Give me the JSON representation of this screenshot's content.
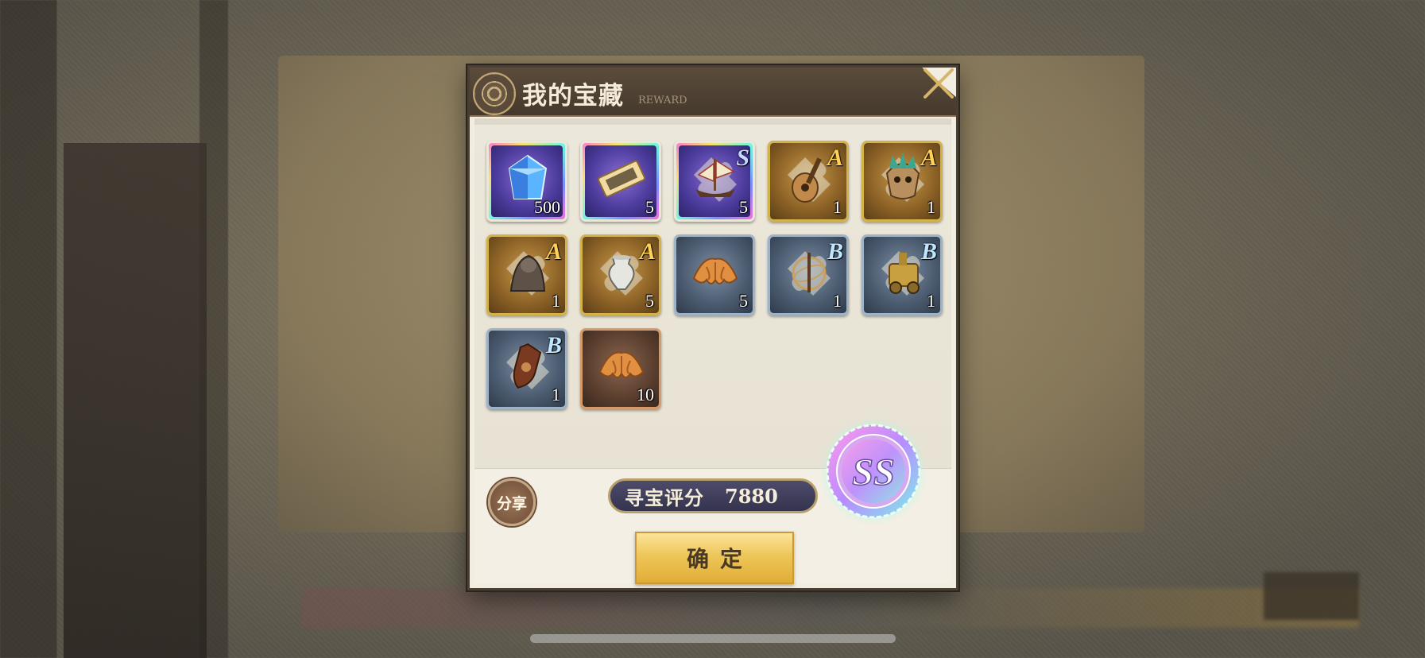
{
  "dialog": {
    "title": "我的宝藏",
    "subtitle": "REWARD",
    "close_icon": "close-x-icon"
  },
  "items": [
    {
      "icon": "blue-crystal-icon",
      "rarity": "rainbow",
      "frame": "purple",
      "grade": "",
      "count": "500"
    },
    {
      "icon": "gold-ticket-icon",
      "rarity": "rainbow",
      "frame": "purple",
      "grade": "",
      "count": "5"
    },
    {
      "icon": "sailing-ship-puzzle-icon",
      "rarity": "rainbow",
      "frame": "purple",
      "grade": "S",
      "count": "5"
    },
    {
      "icon": "lute-puzzle-icon",
      "rarity": "gold",
      "frame": "gold",
      "grade": "A",
      "count": "1"
    },
    {
      "icon": "tribal-mask-puzzle-icon",
      "rarity": "gold",
      "frame": "gold",
      "grade": "A",
      "count": "1"
    },
    {
      "icon": "stone-statue-puzzle-icon",
      "rarity": "gold",
      "frame": "gold",
      "grade": "A",
      "count": "1"
    },
    {
      "icon": "silver-urn-puzzle-icon",
      "rarity": "gold",
      "frame": "gold",
      "grade": "A",
      "count": "5"
    },
    {
      "icon": "croissant-icon",
      "rarity": "silver",
      "frame": "silver",
      "grade": "",
      "count": "5"
    },
    {
      "icon": "astrolabe-puzzle-icon",
      "rarity": "silver",
      "frame": "silver",
      "grade": "B",
      "count": "1"
    },
    {
      "icon": "golden-machine-puzzle-icon",
      "rarity": "silver",
      "frame": "silver",
      "grade": "B",
      "count": "1"
    },
    {
      "icon": "shield-puzzle-icon",
      "rarity": "silver",
      "frame": "silver",
      "grade": "B",
      "count": "1"
    },
    {
      "icon": "croissant-icon",
      "rarity": "bronze",
      "frame": "bronze",
      "grade": "",
      "count": "10"
    }
  ],
  "footer": {
    "share_label": "分享",
    "score_label": "寻宝评分",
    "score_value": "7880",
    "confirm_label": "确定",
    "rank": "SS"
  },
  "colors": {
    "header": "#45392d",
    "panel": "#f1ede1",
    "score_bar": "#35344f",
    "confirm": "#eec659",
    "gold_frame": "#d4b24a",
    "silver_frame": "#9fb3c8"
  }
}
